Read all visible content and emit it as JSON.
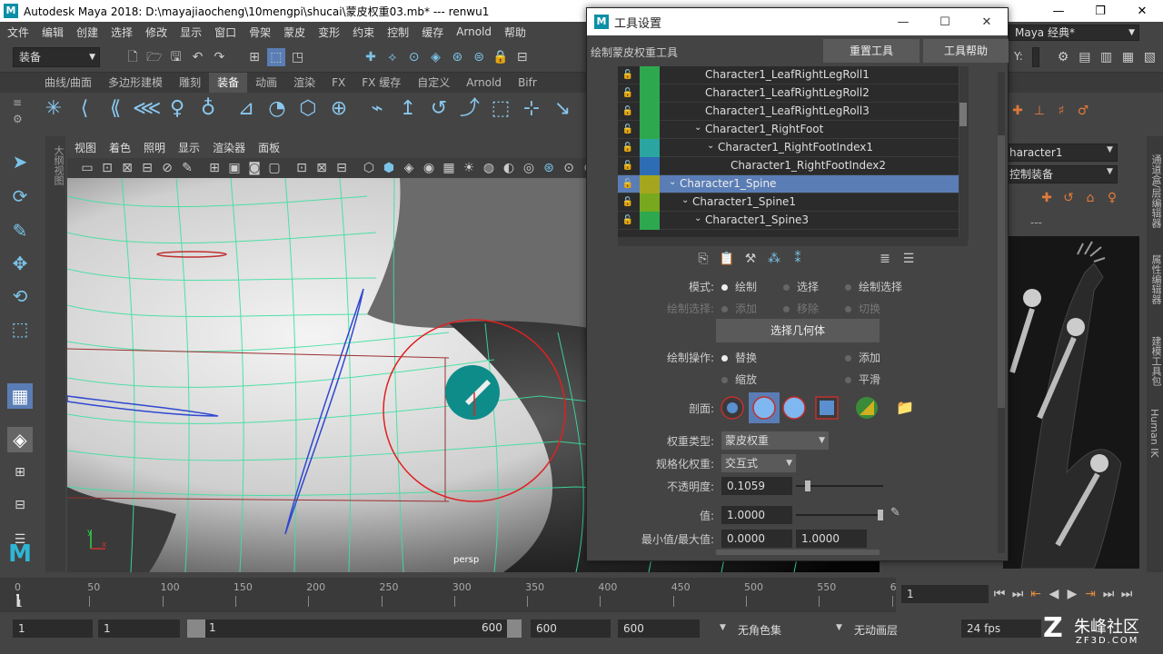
{
  "window": {
    "title": "Autodesk Maya 2018: D:\\mayajiaocheng\\10mengpi\\shucai\\蒙皮权重03.mb*   ---   renwu1"
  },
  "menu": [
    "文件",
    "编辑",
    "创建",
    "选择",
    "修改",
    "显示",
    "窗口",
    "骨架",
    "蒙皮",
    "变形",
    "约束",
    "控制",
    "缓存",
    "Arnold",
    "帮助"
  ],
  "status": {
    "mode_combo": "装备",
    "workspace": "Maya 经典*",
    "y_label": "Y:"
  },
  "shelf_tabs": [
    "曲线/曲面",
    "多边形建模",
    "雕刻",
    "装备",
    "动画",
    "渲染",
    "FX",
    "FX 缓存",
    "自定义",
    "Arnold",
    "Bifr"
  ],
  "shelf_active_index": 3,
  "outliner_strip": "大纲视图",
  "viewport": {
    "menu": [
      "视图",
      "着色",
      "照明",
      "显示",
      "渲染器",
      "面板"
    ],
    "camera": "persp",
    "axis_x": "x",
    "axis_y": "y"
  },
  "right_panel": {
    "field1": "haracter1",
    "field2": "控制装备",
    "dashes": "---",
    "side_tabs": [
      "通道盒/层编辑器",
      "属性编辑器",
      "建模工具包",
      "Human IK"
    ]
  },
  "dialog": {
    "title": "工具设置",
    "tool_name": "绘制蒙皮权重工具",
    "reset_button": "重置工具",
    "help_button": "工具帮助",
    "influences": [
      {
        "name": "Character1_LeafRightLegRoll1",
        "color": "#2ea84f",
        "indent": 3,
        "arrow": ""
      },
      {
        "name": "Character1_LeafRightLegRoll2",
        "color": "#2ea84f",
        "indent": 3,
        "arrow": ""
      },
      {
        "name": "Character1_LeafRightLegRoll3",
        "color": "#2ea84f",
        "indent": 3,
        "arrow": ""
      },
      {
        "name": "Character1_RightFoot",
        "color": "#2ea84f",
        "indent": 3,
        "arrow": "⌄"
      },
      {
        "name": "Character1_RightFootIndex1",
        "color": "#2aa5a0",
        "indent": 4,
        "arrow": "⌄"
      },
      {
        "name": "Character1_RightFootIndex2",
        "color": "#2d6db5",
        "indent": 5,
        "arrow": ""
      },
      {
        "name": "Character1_Spine",
        "color": "#a6a61e",
        "indent": 1,
        "arrow": "⌄",
        "selected": true
      },
      {
        "name": "Character1_Spine1",
        "color": "#77a81e",
        "indent": 2,
        "arrow": "⌄"
      },
      {
        "name": "Character1_Spine3",
        "color": "#2ea84f",
        "indent": 3,
        "arrow": "⌄"
      }
    ],
    "mode_label": "模式:",
    "mode_options": [
      "绘制",
      "选择",
      "绘制选择"
    ],
    "paint_select_label": "绘制选择:",
    "paint_select_options": [
      "添加",
      "移除",
      "切换"
    ],
    "select_geometry_button": "选择几何体",
    "paint_op_label": "绘制操作:",
    "paint_ops": [
      "替换",
      "添加",
      "缩放",
      "平滑"
    ],
    "profile_label": "剖面:",
    "weight_type_label": "权重类型:",
    "weight_type_value": "蒙皮权重",
    "normalize_label": "规格化权重:",
    "normalize_value": "交互式",
    "opacity_label": "不透明度:",
    "opacity_value": "0.1059",
    "opacity_level": 0.1059,
    "value_label": "值:",
    "value_value": "1.0000",
    "value_level": 1.0,
    "minmax_label": "最小值/最大值:",
    "min_value": "0.0000",
    "max_value": "1.0000"
  },
  "timeline": {
    "ticks": [
      "0",
      "50",
      "100",
      "150",
      "200",
      "250",
      "300",
      "350",
      "400",
      "450",
      "500",
      "550",
      "6"
    ],
    "current_frame": "1",
    "current_marker": "1"
  },
  "range": {
    "start": "1",
    "start2": "1",
    "slider_start": "1",
    "slider_end": "600",
    "end1": "600",
    "end2": "600",
    "char_set": "无角色集",
    "anim_layer": "无动画层",
    "fps": "24 fps"
  },
  "watermark": {
    "brand": "朱峰社区",
    "url": "ZF3D.COM"
  },
  "colors": {
    "accent": "#5a7db5",
    "brush_ring": "#e02020",
    "wireframe": "#3de0a0"
  }
}
